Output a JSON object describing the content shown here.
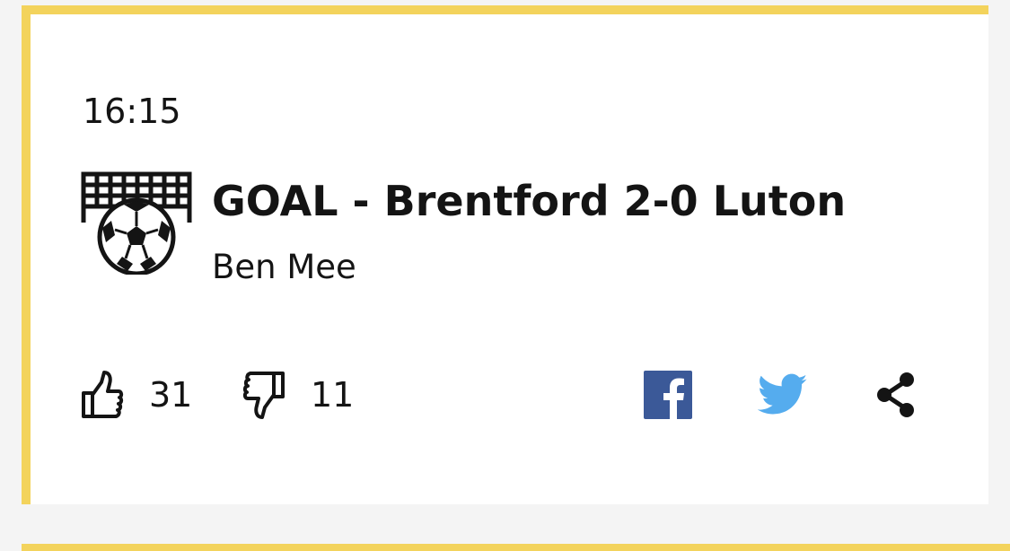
{
  "entry": {
    "time": "16:15",
    "headline": "GOAL - Brentford 2-0 Luton",
    "scorer": "Ben Mee",
    "event_icon": "goal-icon"
  },
  "reactions": {
    "like": {
      "icon": "thumbs-up-icon",
      "count": "31"
    },
    "dislike": {
      "icon": "thumbs-down-icon",
      "count": "11"
    }
  },
  "share": [
    {
      "icon": "facebook-icon",
      "color": "#3b5998"
    },
    {
      "icon": "twitter-icon",
      "color": "#55acee"
    },
    {
      "icon": "share-icon",
      "color": "#141414"
    }
  ],
  "colors": {
    "accent": "#f3d35c",
    "background": "#f4f4f4",
    "card": "#ffffff",
    "text": "#141414"
  }
}
